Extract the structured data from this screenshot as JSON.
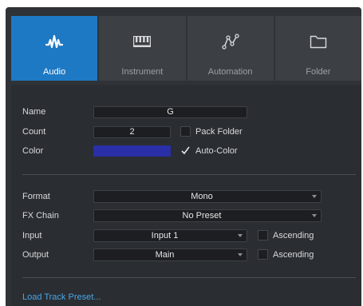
{
  "tabs": [
    {
      "label": "Audio",
      "icon": "audio-waveform-icon",
      "active": true
    },
    {
      "label": "Instrument",
      "icon": "piano-keys-icon",
      "active": false
    },
    {
      "label": "Automation",
      "icon": "automation-curve-icon",
      "active": false
    },
    {
      "label": "Folder",
      "icon": "folder-icon",
      "active": false
    }
  ],
  "track": {
    "name_label": "Name",
    "name_value": "G",
    "count_label": "Count",
    "count_value": "2",
    "pack_folder_label": "Pack Folder",
    "pack_folder_checked": false,
    "color_label": "Color",
    "color_value": "#2a2fa8",
    "auto_color_label": "Auto-Color",
    "auto_color_checked": true
  },
  "io": {
    "format_label": "Format",
    "format_value": "Mono",
    "fx_chain_label": "FX Chain",
    "fx_chain_value": "No Preset",
    "input_label": "Input",
    "input_value": "Input 1",
    "input_ascending_label": "Ascending",
    "input_ascending_checked": false,
    "output_label": "Output",
    "output_value": "Main",
    "output_ascending_label": "Ascending",
    "output_ascending_checked": false
  },
  "footer": {
    "load_preset_label": "Load Track Preset..."
  },
  "colors": {
    "accent": "#1e79c4",
    "link": "#4aa6e8",
    "panel": "#2f3337"
  }
}
